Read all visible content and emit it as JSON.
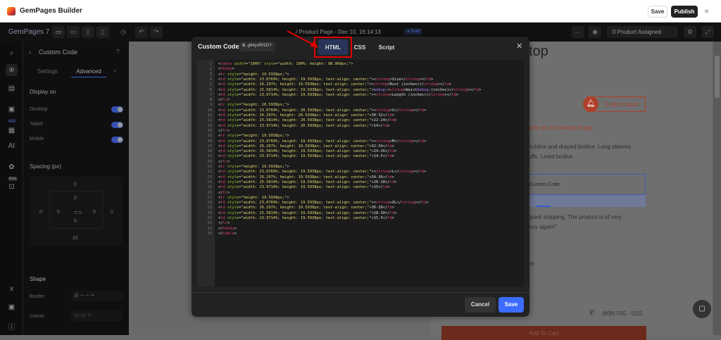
{
  "window": {
    "title": "GemPages Builder",
    "save": "Save",
    "publish": "Publish",
    "close": "×"
  },
  "toolbar": {
    "brand": "GemPages 7",
    "page": "/ Product Page - Dec 10, 16:14:13",
    "status": "● Draft",
    "more": "···",
    "assigned": "0 Product Assigned"
  },
  "panel": {
    "title": "Custom Code",
    "tabs": [
      "Settings",
      "Advanced"
    ],
    "display_on": "Display on",
    "devices": [
      "Desktop",
      "Tablet",
      "Mobile"
    ],
    "spacing": "Spacing (px)",
    "spacing_values": {
      "margin_top": "0",
      "padding_top": "0",
      "margin_left": "0",
      "padding_left": "0",
      "padding_right": "0",
      "margin_right": "0",
      "padding_bottom": "0",
      "margin_bottom": "32"
    },
    "shape": "Shape",
    "border": "Border",
    "corner": "Corner",
    "badge_count": "450",
    "beta": "Beta"
  },
  "modal": {
    "title": "Custom Code",
    "element_id": ".g64yuRr5DY",
    "tabs": [
      "HTML",
      "CSS",
      "Script"
    ],
    "active_tab": "HTML",
    "cancel": "Cancel",
    "save": "Save",
    "code": [
      "<table width=\"100%\" style=\"width: 100%; height: 98.969px;\">",
      "<tbody>",
      "<tr style=\"height: 19.5938px;\">",
      "<td style=\"width: 23.0769%; height: 19.5938px; text-align: center;\"><strong>Size</strong></td>",
      "<td style=\"width: 26.297%; height: 19.5938px; text-align: center;\"><strong>Bust (inches)</strong></td>",
      "<td style=\"width: 25.5814%; height: 19.5938px; text-align: center;\">&nbsp;<strong>Waist&nbsp;(inches)</strong></td>",
      "<td style=\"width: 23.9714%; height: 19.5938px; text-align: center;\"><strong>Length (inches)</strong></td>",
      "</tr>",
      "<tr style=\"height: 20.5938px;\">",
      "<td style=\"width: 23.0769%; height: 20.5938px; text-align: center;\"><strong>S</strong></td>",
      "<td style=\"width: 26.297%; height: 20.5938px; text-align: center;\">30-32</td>",
      "<td style=\"width: 25.5814%; height: 20.5938px; text-align: center;\">22-24</td>",
      "<td style=\"width: 23.9714%; height: 20.5938px; text-align: center;\">14</td>",
      "</tr>",
      "<tr style=\"height: 19.5938px;\">",
      "<td style=\"width: 23.0769%; height: 19.5938px; text-align: center;\"><strong>M</strong></td>",
      "<td style=\"width: 26.297%; height: 19.5938px; text-align: center;\">32-34</td>",
      "<td style=\"width: 25.5814%; height: 19.5938px; text-align: center;\">24-26</td>",
      "<td style=\"width: 23.9714%; height: 19.5938px; text-align: center;\">14.5</td>",
      "</tr>",
      "<tr style=\"height: 19.5938px;\">",
      "<td style=\"width: 23.0769%; height: 19.5938px; text-align: center;\"><strong>L</strong></td>",
      "<td style=\"width: 26.297%; height: 19.5938px; text-align: center;\">34-36</td>",
      "<td style=\"width: 25.5814%; height: 19.5938px; text-align: center;\">26-28</td>",
      "<td style=\"width: 23.9714%; height: 19.5938px; text-align: center;\">15</td>",
      "</tr>",
      "<tr style=\"height: 19.5938px;\">",
      "<td style=\"width: 23.0769%; height: 19.5938px; text-align: center;\"><strong>XL</strong></td>",
      "<td style=\"width: 26.297%; height: 19.5938px; text-align: center;\">36-38</td>",
      "<td style=\"width: 25.5814%; height: 19.5938px; text-align: center;\">28-30</td>",
      "<td style=\"width: 23.9714%; height: 19.5938px; text-align: center;\">15.5</td>",
      "</tr>",
      "</tbody>",
      "</table>"
    ]
  },
  "page": {
    "title_fragment": "top",
    "stock": "5 left in stock",
    "notice": "e same as the sample image",
    "desc1": "e neckline and draped bodice. Long sleeves",
    "desc2": "d cuffs. Lined bodice.",
    "custom_code_label": "Custom Code",
    "review1": "quick shipping. The product is of very",
    "review2": "buy again!\"",
    "fragment": "ed",
    "phone": "(808) 555 - 0111",
    "add_to_cart": "Add To Cart"
  },
  "colors": {
    "accent": "#3b6cff",
    "highlight": "#e00000",
    "stock": "#c0392b"
  }
}
